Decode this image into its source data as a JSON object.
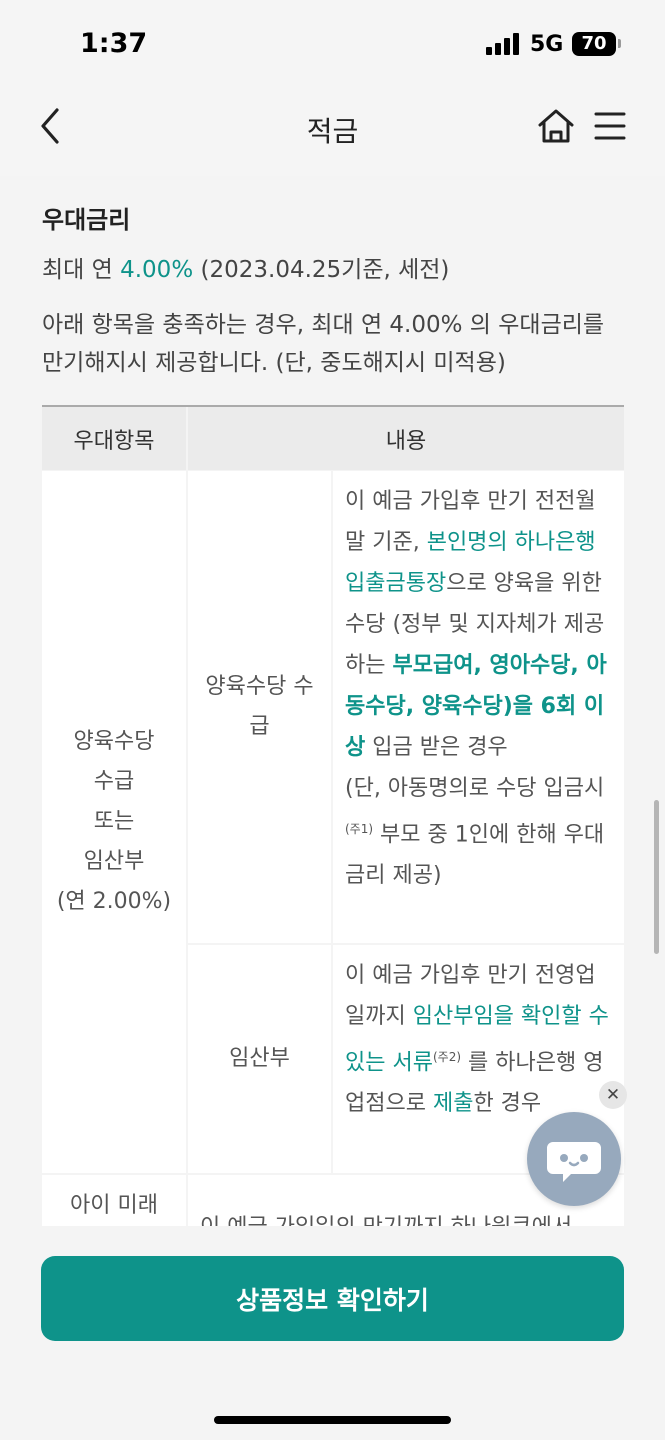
{
  "status_bar": {
    "time": "1:37",
    "network": "5G",
    "battery": "70"
  },
  "nav": {
    "title": "적금"
  },
  "section": {
    "title": "우대금리",
    "rate_prefix": "최대 연 ",
    "rate_value": "4.00%",
    "rate_suffix": " (2023.04.25기준, 세전)",
    "description": "아래 항목을 충족하는 경우, 최대 연 4.00% 의 우대금리를 만기해지시 제공합니다. (단, 중도해지시 미적용)"
  },
  "table": {
    "headers": {
      "item": "우대항목",
      "content": "내용"
    },
    "group1": {
      "label_lines": [
        "양육수당",
        "수급",
        "또는",
        "임산부",
        "(연 2.00%)"
      ],
      "row1": {
        "sub_label": "양육수당 수급",
        "t1": "이 예금 가입후 만기 전전월말 기준, ",
        "t2": "본인명의 하나은행 입출금통장",
        "t3": "으로 양육을 위한 수당 (정부 및 지자체가 제공하는 ",
        "t4": "부모급여, 영아수당, 아동수당, 양육수당)을 6회 이상",
        "t5": " 입금 받은 경우",
        "t6": "(단, 아동명의로 수당 입금시 ",
        "note": "(주1)",
        "t7": " 부모 중 1인에 한해 우대금리 제공)"
      },
      "row2": {
        "sub_label": "임산부",
        "t1": "이 예금 가입후 만기 전영업일까지 ",
        "t2": "임산부임을 확인할 수 있는 서류",
        "note": "(주2)",
        "t3": " 를 하나은행 영업점으로 ",
        "t4": "제출",
        "t5": "한 경우"
      }
    },
    "group2": {
      "label": "아이 미래",
      "content": "이 예금 가입일의 만기까지 하나원큐에서"
    }
  },
  "cta": {
    "label": "상품정보 확인하기"
  },
  "colors": {
    "accent": "#0e938a",
    "chat_fab": "#97a9bd",
    "background": "#f4f4f4"
  },
  "icons": [
    "back-icon",
    "home-icon",
    "menu-icon",
    "chat-icon",
    "close-icon",
    "signal-icon",
    "battery-icon"
  ]
}
